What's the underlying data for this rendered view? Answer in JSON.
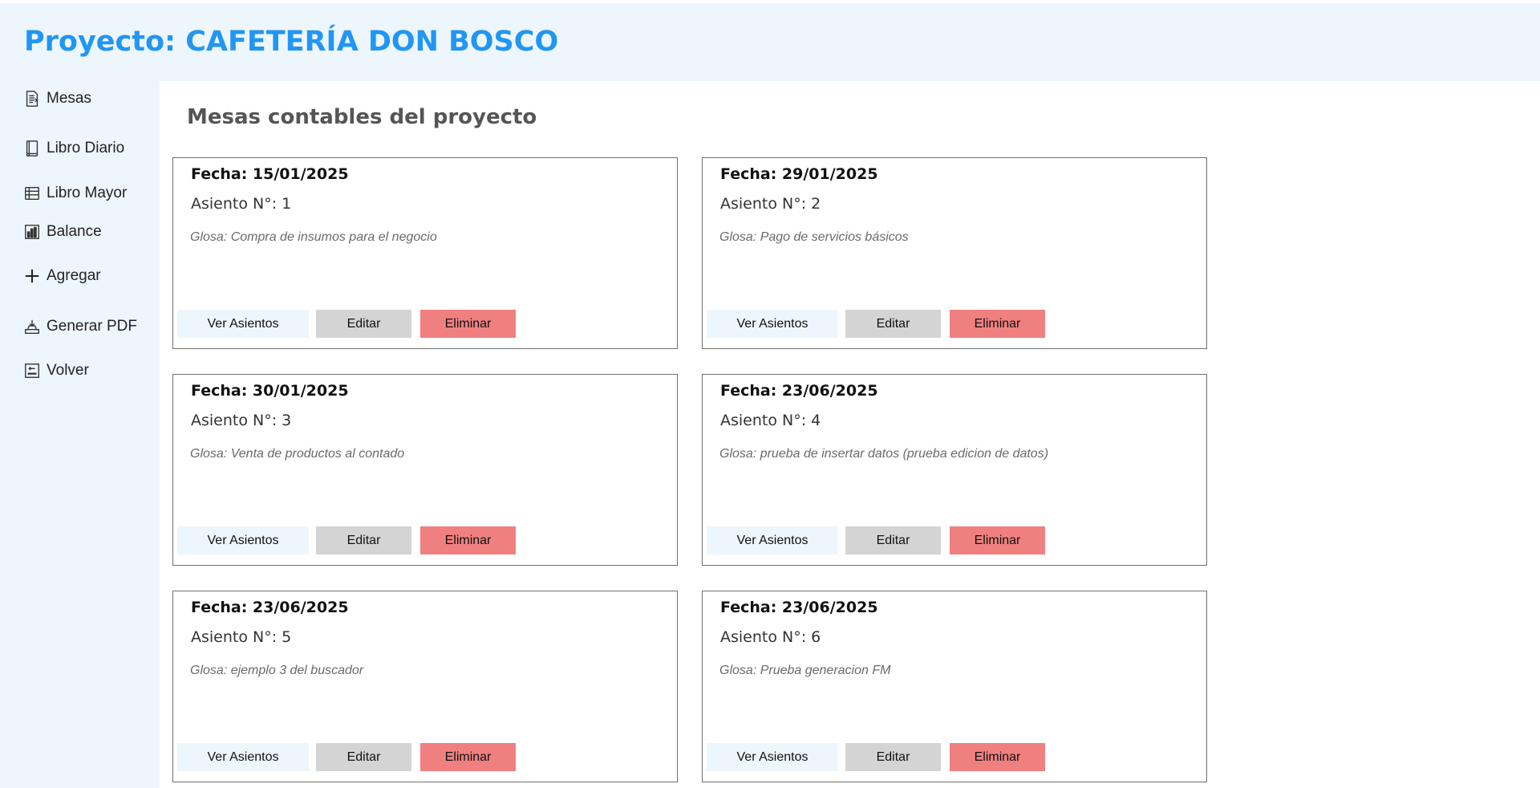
{
  "header": {
    "title": "Proyecto: CAFETERÍA DON BOSCO"
  },
  "sidebar": {
    "items": [
      {
        "label": "Mesas",
        "icon": "document-icon"
      },
      {
        "label": "Libro Diario",
        "icon": "book-icon"
      },
      {
        "label": "Libro Mayor",
        "icon": "ledger-icon"
      },
      {
        "label": "Balance",
        "icon": "bar-chart-icon"
      },
      {
        "label": "Agregar",
        "icon": "plus-icon"
      },
      {
        "label": "Generar PDF",
        "icon": "pdf-export-icon"
      },
      {
        "label": "Volver",
        "icon": "back-icon"
      }
    ]
  },
  "main": {
    "title": "Mesas contables del proyecto",
    "cards": [
      {
        "date": "Fecha: 15/01/2025",
        "asiento": "Asiento N°: 1",
        "glosa": "Glosa: Compra de insumos para el negocio"
      },
      {
        "date": "Fecha: 29/01/2025",
        "asiento": "Asiento N°: 2",
        "glosa": "Glosa: Pago de servicios básicos"
      },
      {
        "date": "Fecha: 30/01/2025",
        "asiento": "Asiento N°: 3",
        "glosa": "Glosa: Venta de productos al contado"
      },
      {
        "date": "Fecha: 23/06/2025",
        "asiento": "Asiento N°: 4",
        "glosa": "Glosa: prueba de insertar datos (prueba edicion de datos)"
      },
      {
        "date": "Fecha: 23/06/2025",
        "asiento": "Asiento N°: 5",
        "glosa": "Glosa: ejemplo 3 del buscador"
      },
      {
        "date": "Fecha: 23/06/2025",
        "asiento": "Asiento N°: 6",
        "glosa": "Glosa: Prueba generacion FM"
      }
    ],
    "buttons": {
      "ver": "Ver Asientos",
      "editar": "Editar",
      "eliminar": "Eliminar"
    }
  },
  "colors": {
    "title": "#2196f3",
    "background": "#eef6fd",
    "edit": "#d4d4d4",
    "delete": "#f08080"
  }
}
